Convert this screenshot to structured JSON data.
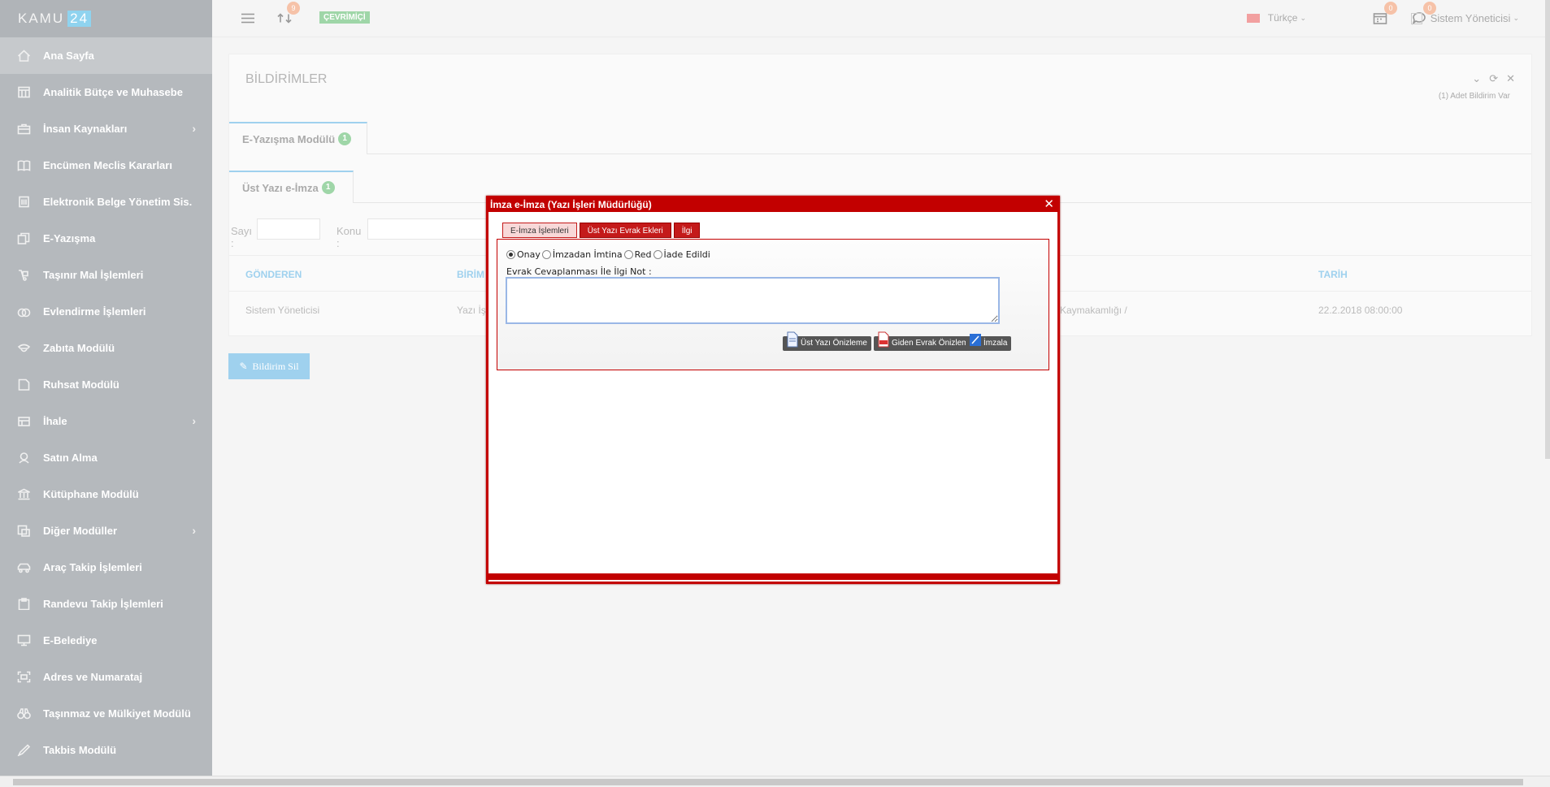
{
  "brand": {
    "name": "KAMU",
    "number": "24"
  },
  "sidebar": {
    "items": [
      {
        "label": "Ana Sayfa",
        "icon": "home-icon",
        "active": true,
        "has_children": false
      },
      {
        "label": "Analitik Bütçe ve Muhasebe",
        "icon": "calculator-icon",
        "has_children": false
      },
      {
        "label": "İnsan Kaynakları",
        "icon": "briefcase-icon",
        "has_children": true
      },
      {
        "label": "Encümen Meclis Kararları",
        "icon": "book-icon",
        "has_children": false
      },
      {
        "label": "Elektronik Belge Yönetim Sis.",
        "icon": "building-icon",
        "has_children": false
      },
      {
        "label": "E-Yazışma",
        "icon": "documents-icon",
        "has_children": false
      },
      {
        "label": "Taşınır Mal İşlemleri",
        "icon": "dolly-icon",
        "has_children": false
      },
      {
        "label": "Evlendirme İşlemleri",
        "icon": "rings-icon",
        "has_children": false
      },
      {
        "label": "Zabıta Modülü",
        "icon": "police-icon",
        "has_children": false
      },
      {
        "label": "Ruhsat Modülü",
        "icon": "certificate-icon",
        "has_children": false
      },
      {
        "label": "İhale",
        "icon": "gavel-icon",
        "has_children": true
      },
      {
        "label": "Satın Alma",
        "icon": "cart-icon",
        "has_children": false
      },
      {
        "label": "Kütüphane Modülü",
        "icon": "library-icon",
        "has_children": false
      },
      {
        "label": "Diğer Modüller",
        "icon": "modules-icon",
        "has_children": true
      },
      {
        "label": "Araç Takip İşlemleri",
        "icon": "car-icon",
        "has_children": false
      },
      {
        "label": "Randevu Takip İşlemleri",
        "icon": "clipboard-icon",
        "has_children": false
      },
      {
        "label": "E-Belediye",
        "icon": "monitor-icon",
        "has_children": false
      },
      {
        "label": "Adres ve Numarataj",
        "icon": "address-icon",
        "has_children": false
      },
      {
        "label": "Taşınmaz ve Mülkiyet Modülü",
        "icon": "binoculars-icon",
        "has_children": false
      },
      {
        "label": "Takbis Modülü",
        "icon": "pen-icon",
        "has_children": false
      }
    ]
  },
  "header": {
    "sync_badge": "9",
    "status": "ÇEVRİMİÇİ",
    "language": "Türkçe",
    "calendar_badge": "0",
    "chat_badge": "0",
    "user_name": "Sistem Yöneticisi"
  },
  "portlet": {
    "title": "BİLDİRİMLER",
    "note": "(1) Adet Bildirim Var",
    "module_tab": {
      "label": "E-Yazışma Modülü",
      "count": "1"
    },
    "sub_tab": {
      "label": "Üst Yazı e-İmza",
      "count": "1"
    },
    "filters": {
      "sayi_label": "Sayı :",
      "konu_label": "Konu :"
    },
    "table": {
      "headers": {
        "sender": "GÖNDEREN",
        "unit": "BİRİM",
        "date": "TARİH"
      },
      "rows": [
        {
          "sender": "Sistem Yöneticisi",
          "unit": "Yazı İş",
          "institution": "Kaymakamlığı /",
          "date": "22.2.2018 08:00:00"
        }
      ]
    },
    "delete_button": "Bildirim Sil"
  },
  "dialog": {
    "title": "İmza e-İmza (Yazı İşleri Müdürlüğü)",
    "tabs": [
      "E-İmza İşlemleri",
      "Üst Yazı Evrak Ekleri",
      "İlgi"
    ],
    "radios": [
      {
        "label": "Onay",
        "checked": true
      },
      {
        "label": "İmzadan İmtina",
        "checked": false
      },
      {
        "label": "Red",
        "checked": false
      },
      {
        "label": "İade Edildi",
        "checked": false
      }
    ],
    "note_label": "Evrak Cevaplanması İle İlgi Not :",
    "note_value": "",
    "buttons": {
      "preview_top": "Üst Yazı Önizleme",
      "preview_outgoing": "Giden Evrak Önizleme",
      "sign": "İmzala"
    }
  },
  "colors": {
    "accent": "#9fd1ee",
    "dialog_red": "#c20000",
    "success": "#9fd6a8"
  }
}
